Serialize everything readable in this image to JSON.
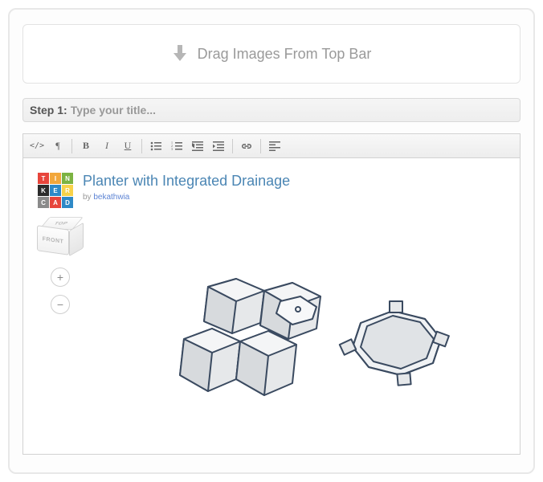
{
  "dropzone": {
    "label": "Drag Images From Top Bar"
  },
  "step": {
    "label": "Step 1:",
    "placeholder": "Type your title..."
  },
  "logo": {
    "letters": [
      "T",
      "I",
      "N",
      "K",
      "E",
      "R",
      "C",
      "A",
      "D"
    ]
  },
  "project": {
    "title": "Planter with Integrated Drainage",
    "byline_prefix": "by",
    "author": "bekathwia"
  },
  "cube": {
    "top": "TOP",
    "front": "FRONT"
  },
  "zoom": {
    "plus": "+",
    "minus": "−"
  }
}
